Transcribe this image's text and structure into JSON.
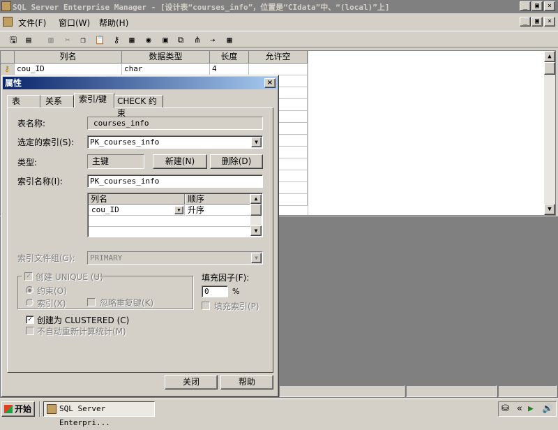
{
  "window": {
    "title": "SQL Server Enterprise Manager - [设计表“courses_info”，位置是“CIdata”中、“(local)”上]",
    "min": "_",
    "max": "▣",
    "close": "×"
  },
  "menu": {
    "items": [
      "文件(F)",
      "窗口(W)",
      "帮助(H)"
    ]
  },
  "grid": {
    "headers": [
      "列名",
      "数据类型",
      "长度",
      "允许空"
    ],
    "rows": [
      {
        "name": "cou_ID",
        "type": "char",
        "length": "4",
        "nullable": ""
      }
    ]
  },
  "dialog": {
    "title": "属性",
    "tabs": [
      "表",
      "关系",
      "索引/键",
      "CHECK 约束"
    ],
    "active_tab": "索引/键",
    "table_name_label": "表名称:",
    "table_name_value": "courses_info",
    "selected_index_label": "选定的索引(S):",
    "selected_index_value": "PK_courses_info",
    "type_label": "类型:",
    "type_value": "主键",
    "new_button": "新建(N)",
    "delete_button": "删除(D)",
    "index_name_label": "索引名称(I):",
    "index_name_value": "PK_courses_info",
    "index_columns": {
      "headers": [
        "列名",
        "顺序"
      ],
      "rows": [
        {
          "column": "cou_ID",
          "order": "升序"
        }
      ]
    },
    "filegroup_label": "索引文件组(G):",
    "filegroup_value": "PRIMARY",
    "create_unique_label": "创建 UNIQUE (U)",
    "constraint_label": "约束(O)",
    "index_label": "索引(X)",
    "ignore_dup_label": "忽略重复键(K)",
    "fill_factor_label": "填充因子(F):",
    "fill_factor_value": "0",
    "percent": "%",
    "pad_index_label": "填充索引(P)",
    "clustered_label": "创建为 CLUSTERED (C)",
    "clustered_checked": true,
    "no_recompute_label": "不自动重新计算统计(M)",
    "close_button": "关闭",
    "help_button": "帮助"
  },
  "taskbar": {
    "start": "开始",
    "task_item": "SQL Server Enterpri..."
  }
}
